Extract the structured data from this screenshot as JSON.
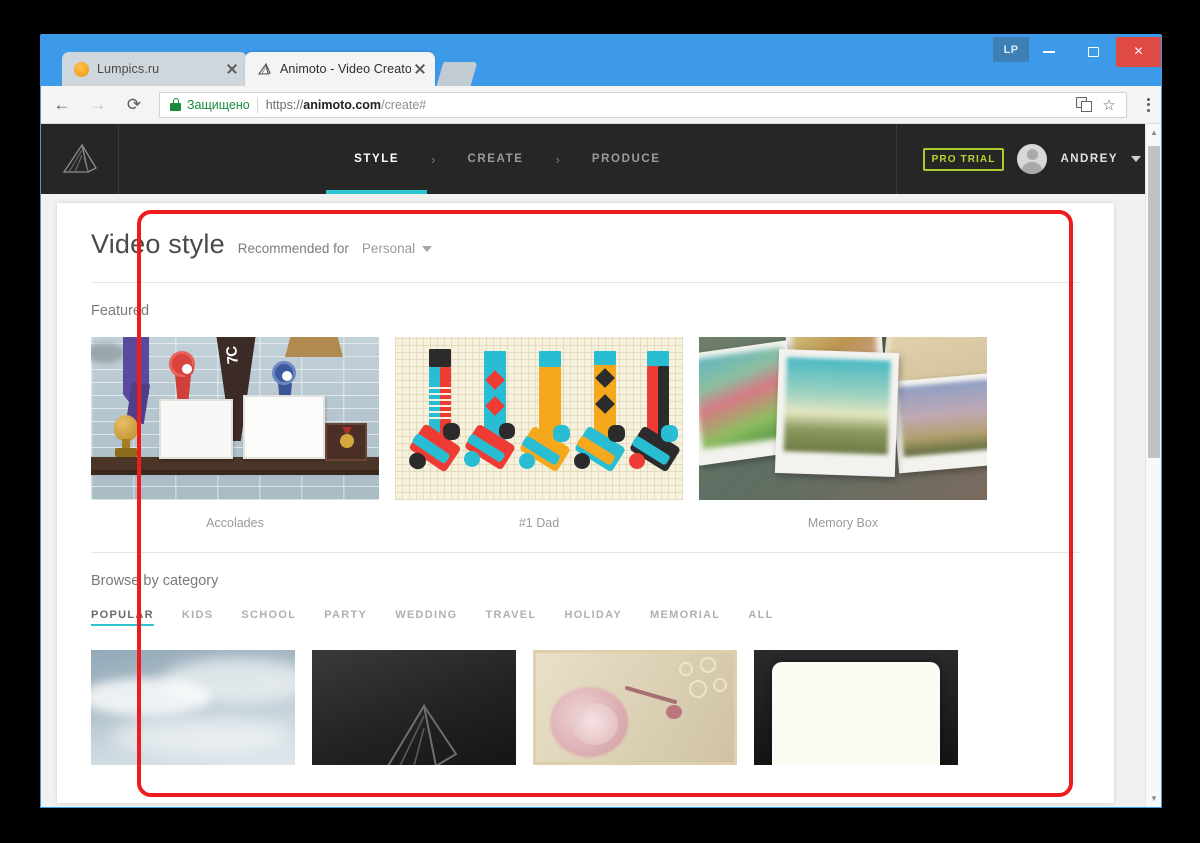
{
  "browser": {
    "tabs": [
      {
        "title": "Lumpics.ru",
        "favicon": "orange-dot-icon",
        "active": false
      },
      {
        "title": "Animoto - Video Creator",
        "favicon": "animoto-logo-icon",
        "active": true
      }
    ],
    "new_tab_label": "",
    "window_controls": {
      "profile_chip": "LP",
      "minimize": "–",
      "maximize": "□",
      "close": "×"
    },
    "toolbar": {
      "back": "←",
      "forward": "→",
      "reload": "⟳",
      "security_icon": "lock-icon",
      "security_label": "Защищено",
      "url_scheme": "https://",
      "url_host": "animoto.com",
      "url_path": "/create#",
      "translate_icon": "translate-icon",
      "bookmark_icon": "☆",
      "menu_icon": "kebab-menu-icon"
    }
  },
  "app_nav": {
    "logo": "animoto-fan-logo",
    "steps": [
      {
        "label": "STYLE",
        "active": true
      },
      {
        "label": "CREATE",
        "active": false
      },
      {
        "label": "PRODUCE",
        "active": false
      }
    ],
    "separator": "›",
    "pro_badge": "PRO TRIAL",
    "username": "ANDREY",
    "accent_color": "#2ec4d4",
    "pro_badge_color": "#b4d62e",
    "nav_background": "#262626"
  },
  "page": {
    "title": "Video style",
    "recommended_label": "Recommended for",
    "recommended_value": "Personal",
    "featured_heading": "Featured",
    "featured": [
      {
        "caption": "Accolades",
        "art": "accolades"
      },
      {
        "caption": "#1 Dad",
        "art": "socks"
      },
      {
        "caption": "Memory Box",
        "art": "polaroids"
      }
    ],
    "browse_heading": "Browse by category",
    "categories": [
      {
        "label": "POPULAR",
        "active": true
      },
      {
        "label": "KIDS",
        "active": false
      },
      {
        "label": "SCHOOL",
        "active": false
      },
      {
        "label": "PARTY",
        "active": false
      },
      {
        "label": "WEDDING",
        "active": false
      },
      {
        "label": "TRAVEL",
        "active": false
      },
      {
        "label": "HOLIDAY",
        "active": false
      },
      {
        "label": "MEMORIAL",
        "active": false
      },
      {
        "label": "ALL",
        "active": false
      }
    ],
    "grid": [
      {
        "art": "clouds"
      },
      {
        "art": "dark-logo"
      },
      {
        "art": "rose"
      },
      {
        "art": "paper"
      }
    ]
  },
  "scrollbar": {
    "up": "▲",
    "down": "▼"
  },
  "annotation": {
    "color": "#ee1c1c"
  }
}
